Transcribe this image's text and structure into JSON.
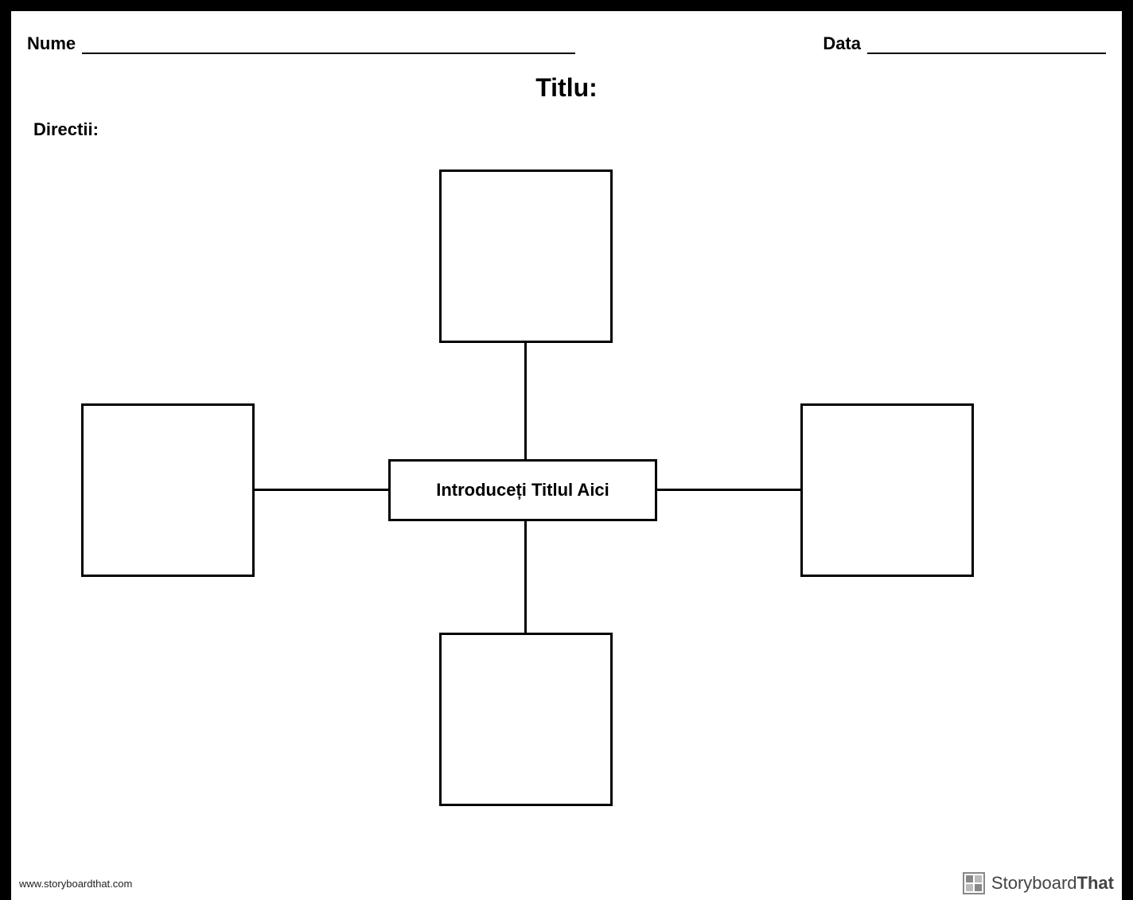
{
  "header": {
    "name_label": "Nume",
    "date_label": "Data"
  },
  "title": "Titlu:",
  "directions_label": "Directii:",
  "diagram": {
    "center_text": "Introduceți Titlul Aici"
  },
  "footer": {
    "url": "www.storyboardthat.com",
    "brand_thin": "Storyboard",
    "brand_bold": "That"
  }
}
